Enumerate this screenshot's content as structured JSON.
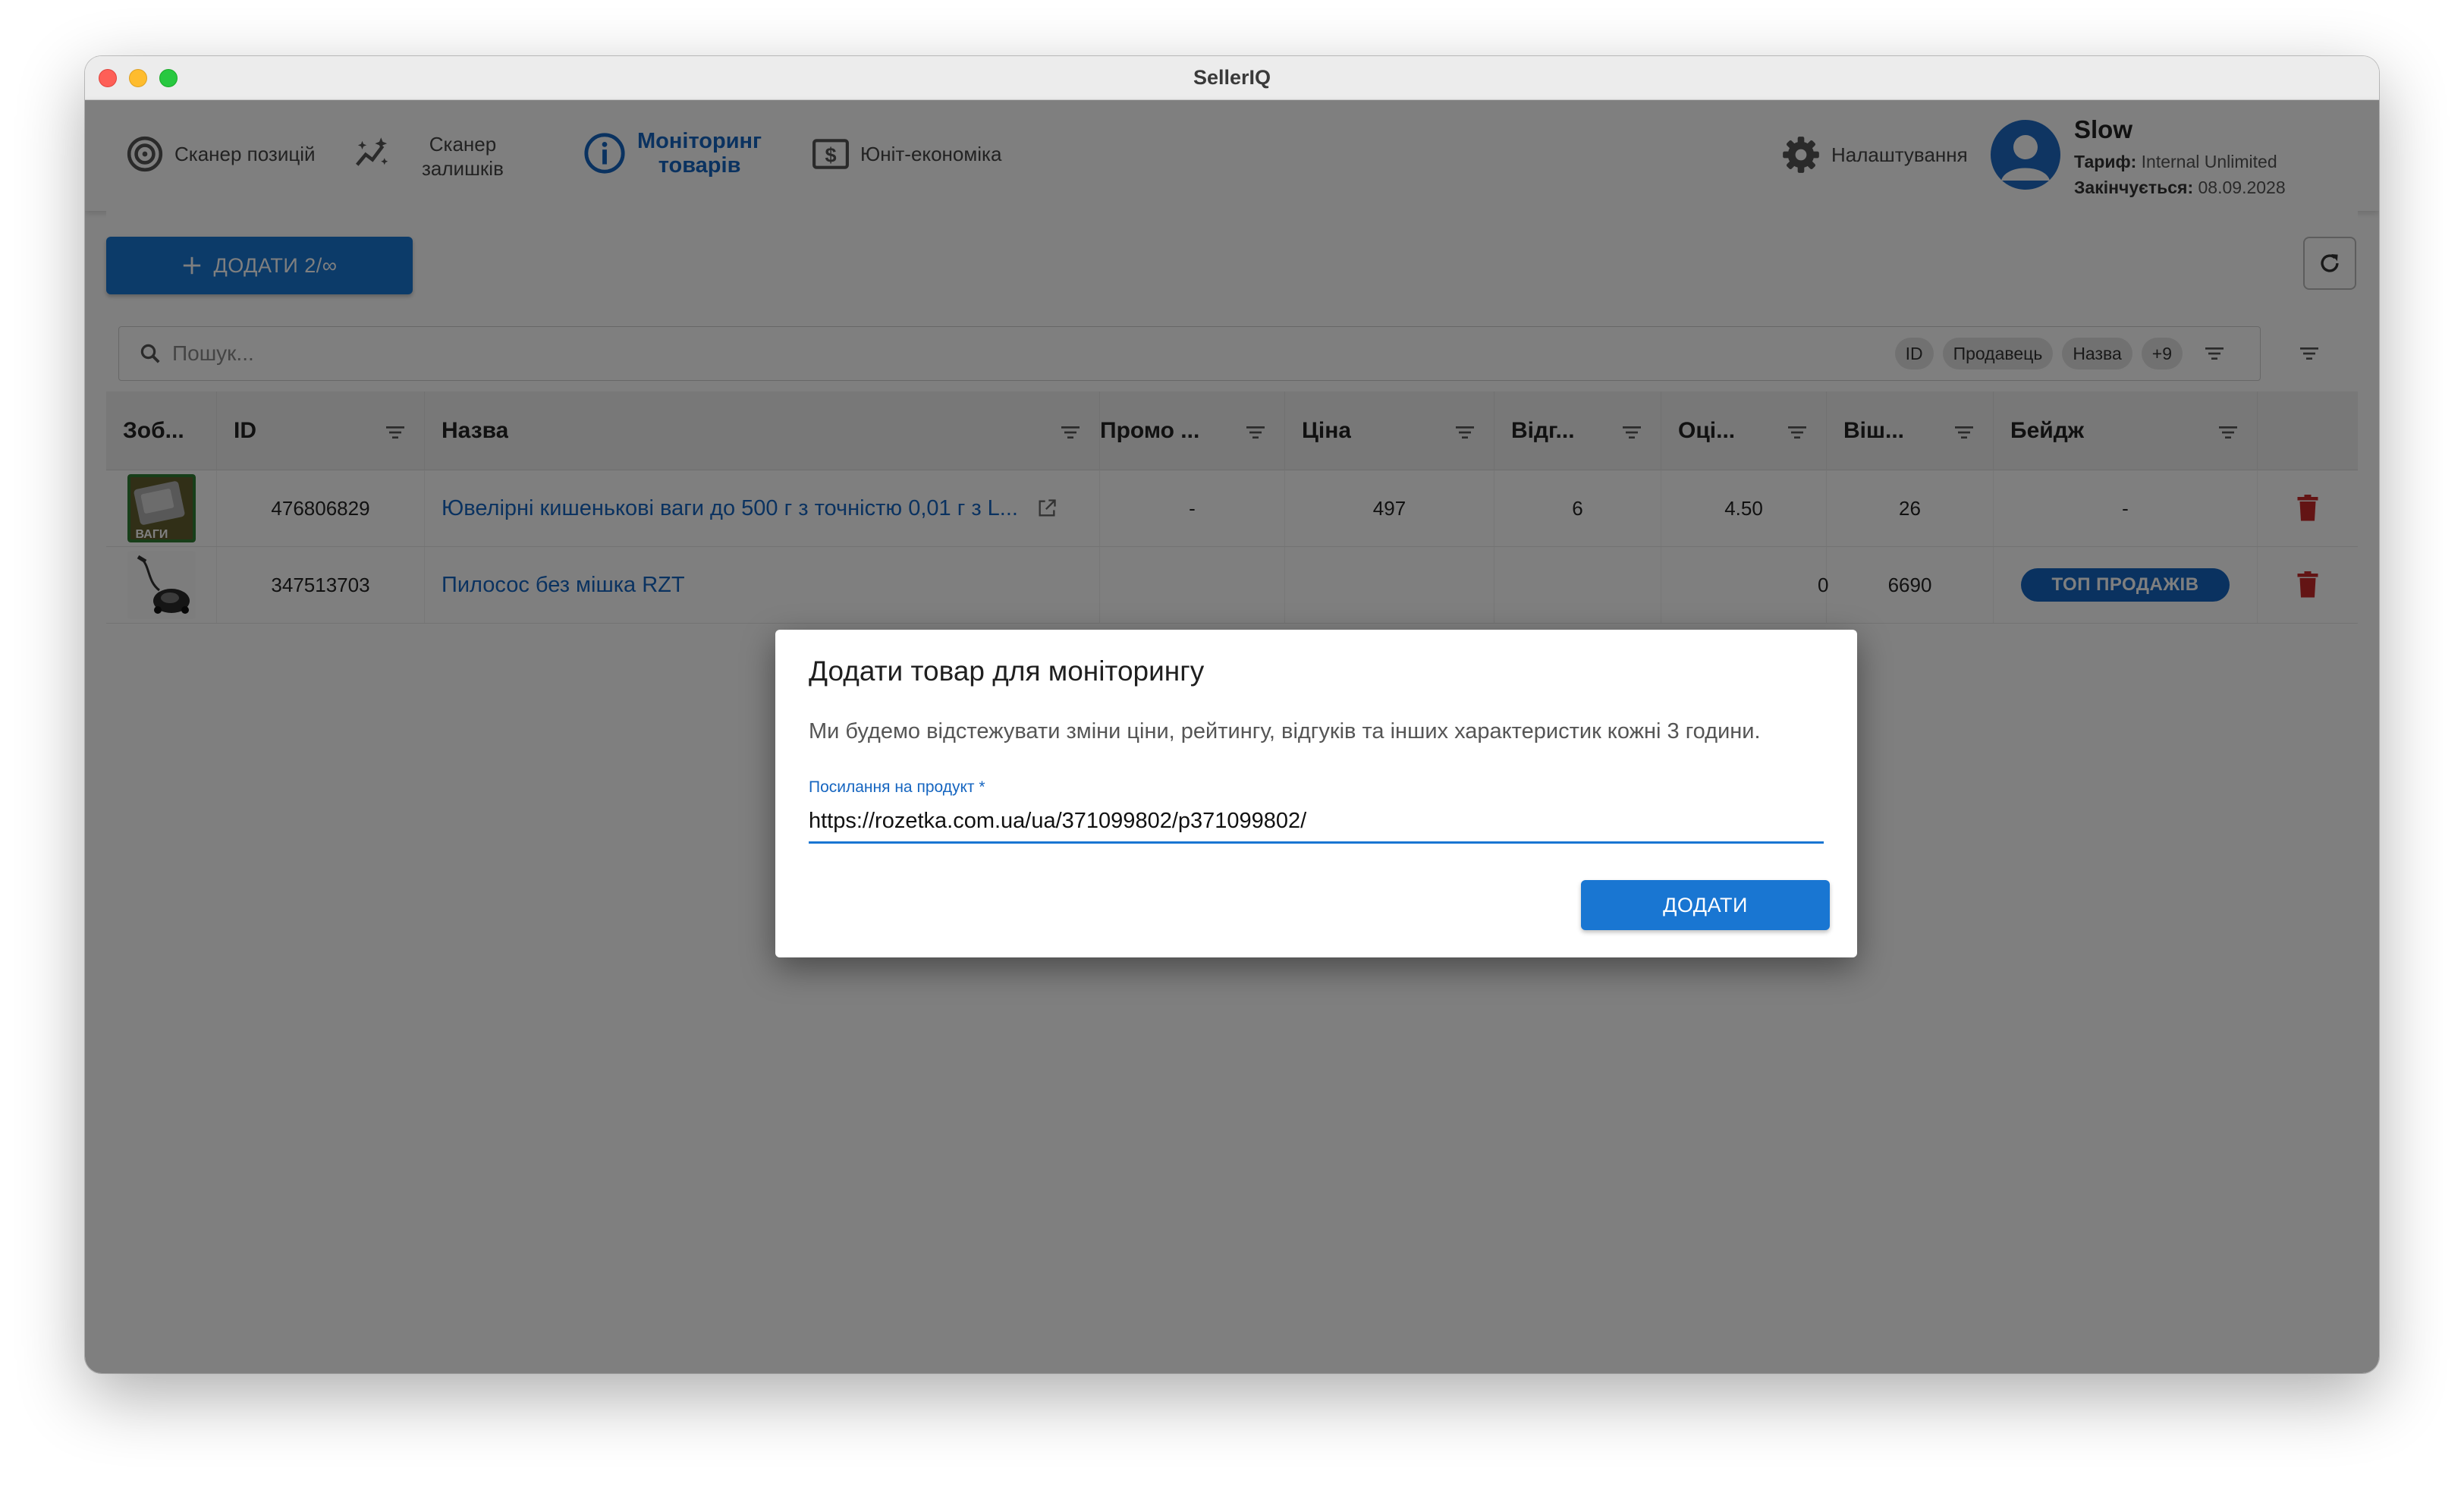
{
  "window": {
    "title": "SellerIQ"
  },
  "nav": {
    "scanner_positions": "Сканер позицій",
    "scanner_stock_l1": "Сканер",
    "scanner_stock_l2": "залишків",
    "monitoring_l1": "Моніторинг",
    "monitoring_l2": "товарів",
    "unit_economics": "Юніт-економіка",
    "settings": "Налаштування"
  },
  "user": {
    "name": "Slow",
    "plan_label": "Тариф:",
    "plan_value": "Internal Unlimited",
    "expires_label": "Закінчується:",
    "expires_value": "08.09.2028"
  },
  "toolbar": {
    "add_label": "ДОДАТИ 2/∞"
  },
  "search": {
    "placeholder": "Пошук...",
    "chips": [
      "ID",
      "Продавець",
      "Назва",
      "+9"
    ]
  },
  "table": {
    "columns": [
      "Зоб...",
      "ID",
      "Назва",
      "Промо ...",
      "Ціна",
      "Відг...",
      "Оці...",
      "Віш...",
      "Бейдж"
    ],
    "rows": [
      {
        "id": "476806829",
        "name": "Ювелірні кишенькові ваги до 500 г з точністю 0,01 г з L...",
        "promo": "-",
        "price": "497",
        "reviews": "6",
        "rating": "4.50",
        "wishlist": "26",
        "badge": "-",
        "thumb_text": "ВАГИ"
      },
      {
        "id": "347513703",
        "name": "Пилосос без мішка RZT",
        "rating_partial": "0",
        "wishlist": "6690",
        "badge": "ТОП ПРОДАЖІВ"
      }
    ]
  },
  "dialog": {
    "title": "Додати товар для моніторингу",
    "description": "Ми будемо відстежувати зміни ціни, рейтингу, відгуків та інших характеристик кожні 3 години.",
    "field_label": "Посилання на продукт *",
    "field_value": "https://rozetka.com.ua/ua/371099802/p371099802/",
    "submit_label": "ДОДАТИ"
  },
  "colors": {
    "accent": "#1976d2",
    "link": "#1565c0",
    "delete": "#c62828"
  }
}
